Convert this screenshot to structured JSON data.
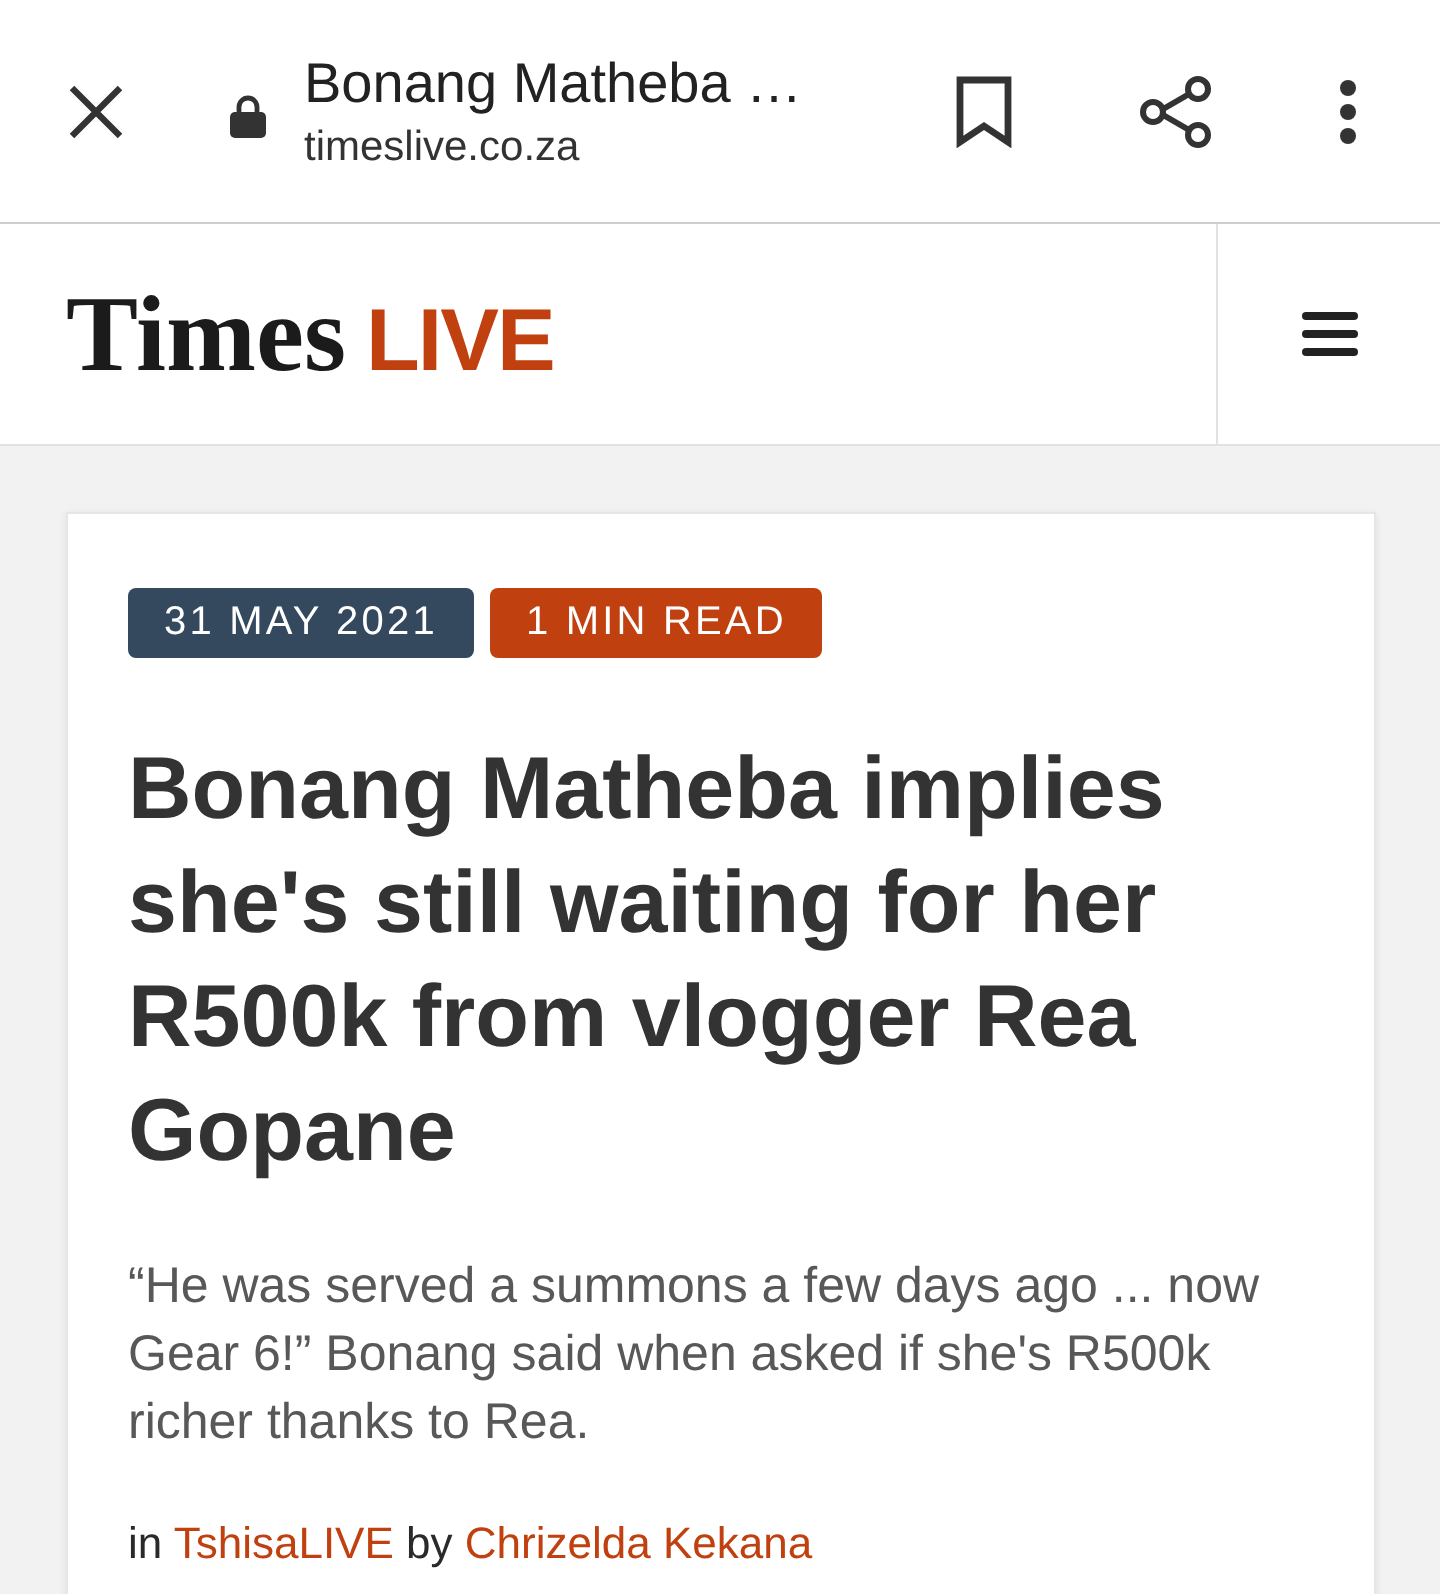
{
  "browser_bar": {
    "title": "Bonang Matheba …",
    "url": "timeslive.co.za"
  },
  "site_header": {
    "logo_text": "Times",
    "logo_accent": "LIVE"
  },
  "article": {
    "badges": [
      {
        "kind": "date",
        "text": "31 MAY 2021"
      },
      {
        "kind": "read_time",
        "text": "1 MIN READ"
      }
    ],
    "headline": "Bonang Matheba implies she's still waiting for her R500k from vlogger Rea Gopane",
    "summary": "“He was served a summons a few days ago ... now Gear 6!” Bonang said when asked if she's R500k richer thanks to Rea.",
    "byline": {
      "prefix": "in",
      "section": "TshisaLIVE",
      "joiner": "by",
      "author": "Chrizelda Kekana"
    }
  }
}
